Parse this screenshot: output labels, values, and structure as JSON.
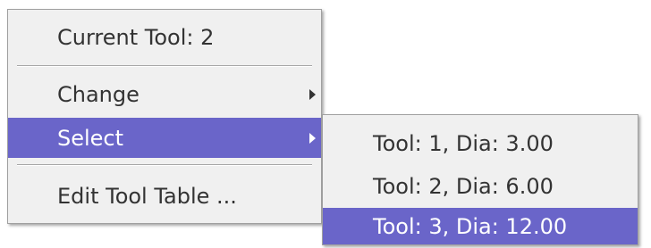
{
  "main_menu": {
    "items": [
      {
        "label": "Current Tool: 2",
        "enabled": false,
        "highlighted": false,
        "has_submenu": false
      },
      {
        "label": "Change",
        "enabled": true,
        "highlighted": false,
        "has_submenu": true,
        "submenu_icon": "triangle-right-icon"
      },
      {
        "label": "Select",
        "enabled": true,
        "highlighted": true,
        "has_submenu": true,
        "submenu_icon": "triangle-right-icon"
      },
      {
        "label": "Edit Tool Table ...",
        "enabled": true,
        "highlighted": false,
        "has_submenu": false
      }
    ]
  },
  "submenu": {
    "parent": "Select",
    "items": [
      {
        "label": "Tool: 1, Dia: 3.00",
        "highlighted": false
      },
      {
        "label": "Tool: 2, Dia: 6.00",
        "highlighted": false
      },
      {
        "label": "Tool: 3, Dia: 12.00",
        "highlighted": true
      }
    ]
  },
  "colors": {
    "menu_background": "#f0f0f0",
    "highlight": "#6a65c9",
    "highlight_text": "#ffffff",
    "text": "#333333",
    "border": "#a0a0a0"
  }
}
